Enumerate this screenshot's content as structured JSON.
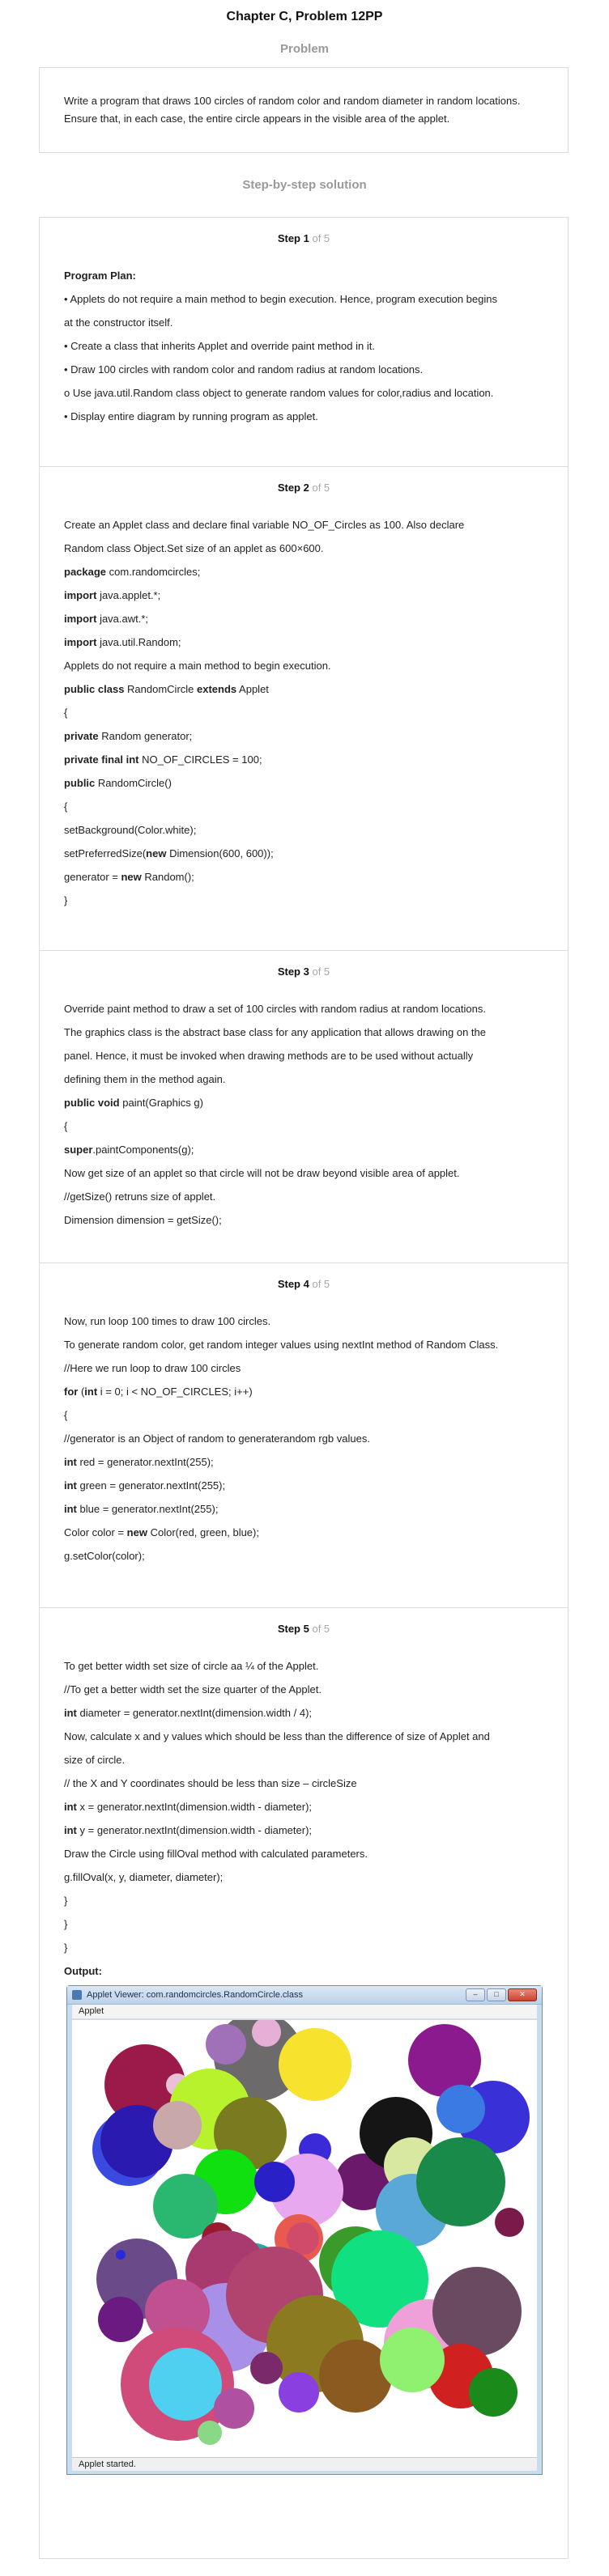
{
  "header": {
    "title": "Chapter C, Problem 12PP",
    "problem_label": "Problem",
    "solution_label": "Step-by-step solution"
  },
  "problem": {
    "text": "Write a program that draws 100 circles of random color and random diameter in random locations. Ensure that, in each case, the entire circle appears in the visible area of the applet."
  },
  "steps": [
    {
      "num": "Step 1",
      "of": "of 5",
      "lines": [
        {
          "b": "Program Plan:",
          "t": ""
        },
        {
          "t": "• Applets do not require a main method to begin execution. Hence, program execution begins"
        },
        {
          "t": "at the constructor itself."
        },
        {
          "t": "• Create a class that inherits Applet and override paint method in it."
        },
        {
          "t": "• Draw 100 circles with random color and random radius at random locations."
        },
        {
          "t": "o Use java.util.Random class object to generate random values for color,radius and location."
        },
        {
          "t": "• Display entire diagram by running program as applet."
        }
      ]
    },
    {
      "num": "Step 2",
      "of": "of 5",
      "lines": [
        {
          "t": "Create an Applet class and declare final variable NO_OF_Circles as 100. Also declare"
        },
        {
          "t": "Random class Object.Set size of an applet as 600×600."
        },
        {
          "b": "package",
          "t": " com.randomcircles;"
        },
        {
          "b": "import",
          "t": " java.applet.*;"
        },
        {
          "b": "import",
          "t": " java.awt.*;"
        },
        {
          "b": "import",
          "t": " java.util.Random;"
        },
        {
          "t": "Applets do not require a main method to begin execution."
        },
        {
          "b": "public class",
          "t": " RandomCircle ",
          "b2": "extends",
          "t2": " Applet"
        },
        {
          "t": "{"
        },
        {
          "b": "private",
          "t": " Random generator;"
        },
        {
          "b": "private final int",
          "t": " NO_OF_CIRCLES = 100;"
        },
        {
          "b": "public",
          "t": " RandomCircle()"
        },
        {
          "t": "{"
        },
        {
          "t": "setBackground(Color.white);"
        },
        {
          "t": "setPreferredSize(",
          "b2": "new",
          "t2": " Dimension(600, 600));"
        },
        {
          "t": "generator = ",
          "b2": "new",
          "t2": " Random();"
        },
        {
          "t": "}"
        }
      ]
    },
    {
      "num": "Step 3",
      "of": "of 5",
      "lines": [
        {
          "t": "Override paint method to draw a set of 100 circles with random radius at random locations."
        },
        {
          "t": "The graphics class is the abstract base class for any application that allows drawing on the"
        },
        {
          "t": "panel. Hence, it must be invoked when drawing methods are to be used without actually"
        },
        {
          "t": "defining them in the method again."
        },
        {
          "b": "public void",
          "t": " paint(Graphics g)"
        },
        {
          "t": "{"
        },
        {
          "b": "super",
          "t": ".paintComponents(g);"
        },
        {
          "t": "Now get size of an applet so that circle will not be draw beyond visible area of applet."
        },
        {
          "t": "//getSize() retruns size of applet."
        },
        {
          "t": "Dimension dimension = getSize();"
        }
      ]
    },
    {
      "num": "Step 4",
      "of": "of 5",
      "lines": [
        {
          "t": "Now, run loop 100 times to draw 100 circles."
        },
        {
          "t": "To generate random color, get random integer values using nextInt method of Random Class."
        },
        {
          "t": "//Here we run loop to draw 100 circles"
        },
        {
          "b": "for",
          "t": " (",
          "b2": "int",
          "t2": " i = 0; i < NO_OF_CIRCLES; i++)"
        },
        {
          "t": "{"
        },
        {
          "t": "//generator is an Object of random to generaterandom rgb values."
        },
        {
          "b": "int",
          "t": " red = generator.nextInt(255);"
        },
        {
          "b": "int",
          "t": " green = generator.nextInt(255);"
        },
        {
          "b": "int",
          "t": " blue = generator.nextInt(255);"
        },
        {
          "t": "Color color = ",
          "b2": "new",
          "t2": " Color(red, green, blue);"
        },
        {
          "t": "g.setColor(color);"
        }
      ]
    },
    {
      "num": "Step 5",
      "of": "of 5",
      "lines": [
        {
          "t": "To get better width set size of circle aa ¼ of the Applet."
        },
        {
          "t": "//To get a better width set the size quarter of the Applet."
        },
        {
          "b": "int",
          "t": " diameter = generator.nextInt(dimension.width / 4);"
        },
        {
          "t": "Now, calculate x and y values which should be less than the difference of size of Applet and"
        },
        {
          "t": "size of circle."
        },
        {
          "t": "// the X and Y coordinates should be less than size – circleSize"
        },
        {
          "b": "int",
          "t": " x = generator.nextInt(dimension.width - diameter);"
        },
        {
          "b": "int",
          "t": " y = generator.nextInt(dimension.width - diameter);"
        },
        {
          "t": "Draw the Circle using fillOval method with calculated parameters."
        },
        {
          "t": "g.fillOval(x, y, diameter, diameter);"
        },
        {
          "t": "}"
        },
        {
          "t": "}"
        },
        {
          "t": "}"
        },
        {
          "b": "Output:",
          "t": ""
        }
      ]
    }
  ],
  "applet": {
    "title": "Applet Viewer: com.randomcircles.RandomCircle.class",
    "menu": "Applet",
    "status": "Applet started.",
    "window_buttons": [
      "–",
      "□",
      "✕"
    ]
  },
  "colors": {
    "border": "#dcdcdc",
    "muted": "#9a9a9a",
    "canvas_bg": "#ffffff"
  }
}
